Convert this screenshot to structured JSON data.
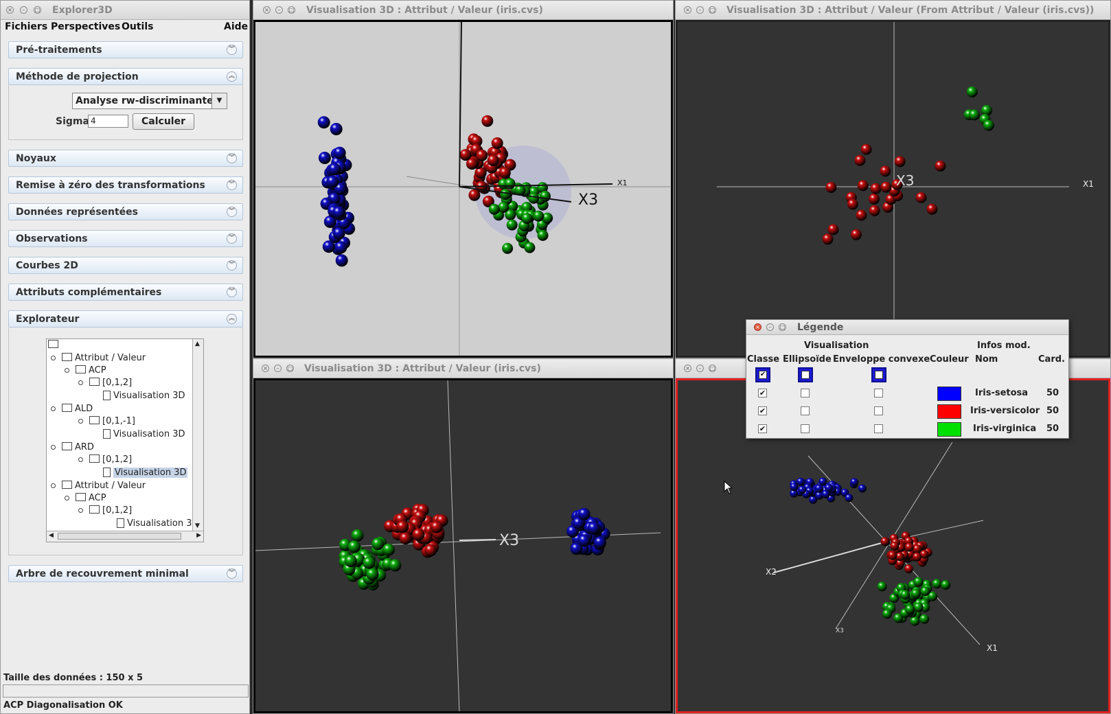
{
  "left": {
    "title": "Explorer3D",
    "menu": [
      "Fichiers",
      "Perspectives",
      "Outils",
      "Aide"
    ],
    "sections": {
      "pre": "Pré-traitements",
      "projection": "Méthode de projection",
      "noyaux": "Noyaux",
      "remise": "Remise à zéro des transformations",
      "donnees": "Données représentées",
      "observations": "Observations",
      "courbes": "Courbes 2D",
      "attributs": "Attributs complémentaires",
      "explorateur": "Explorateur",
      "arbre": "Arbre de recouvrement minimal"
    },
    "projection": {
      "method": "Analyse rw-discriminante",
      "sigma_label": "Sigma",
      "sigma_value": "4",
      "compute_label": "Calculer"
    },
    "tree": [
      {
        "label": "Attribut / Valeur"
      },
      {
        "label": "ACP"
      },
      {
        "label": "[0,1,2]"
      },
      {
        "label": "Visualisation 3D"
      },
      {
        "label": "ALD"
      },
      {
        "label": "[0,1,-1]"
      },
      {
        "label": "Visualisation 3D"
      },
      {
        "label": "ARD"
      },
      {
        "label": "[0,1,2]"
      },
      {
        "label": "Visualisation 3D"
      },
      {
        "label": "Attribut / Valeur"
      },
      {
        "label": "ACP"
      },
      {
        "label": "[0,1,2]"
      },
      {
        "label": "Visualisation 3"
      }
    ],
    "status_size": "Taille des données : 150 x 5",
    "status_msg": "ACP Diagonalisation OK"
  },
  "views": {
    "v1_title": "Visualisation 3D : Attribut / Valeur (iris.cvs)",
    "v2_title": "Visualisation 3D : Attribut / Valeur (From Attribut / Valeur (iris.cvs))",
    "v3_title": "Visualisation 3D : Attribut / Valeur (iris.cvs)",
    "axis_x1": "X1",
    "axis_x2": "X2",
    "axis_x3": "X3"
  },
  "legend": {
    "title": "Légende",
    "group_visu": "Visualisation",
    "group_infos": "Infos mod.",
    "col_classe": "Classe",
    "col_ellipsoide": "Ellipsoïde",
    "col_enveloppe": "Enveloppe convexe",
    "col_couleur": "Couleur",
    "col_nom": "Nom",
    "col_card": "Card.",
    "rows": [
      {
        "name": "Iris-setosa",
        "card": "50",
        "color": "#0000ff"
      },
      {
        "name": "Iris-versicolor",
        "card": "50",
        "color": "#ff0000"
      },
      {
        "name": "Iris-virginica",
        "card": "50",
        "color": "#00e000"
      }
    ]
  },
  "colors": {
    "setosa": "#1010c8",
    "versicolor": "#c81010",
    "virginica": "#10b010"
  }
}
